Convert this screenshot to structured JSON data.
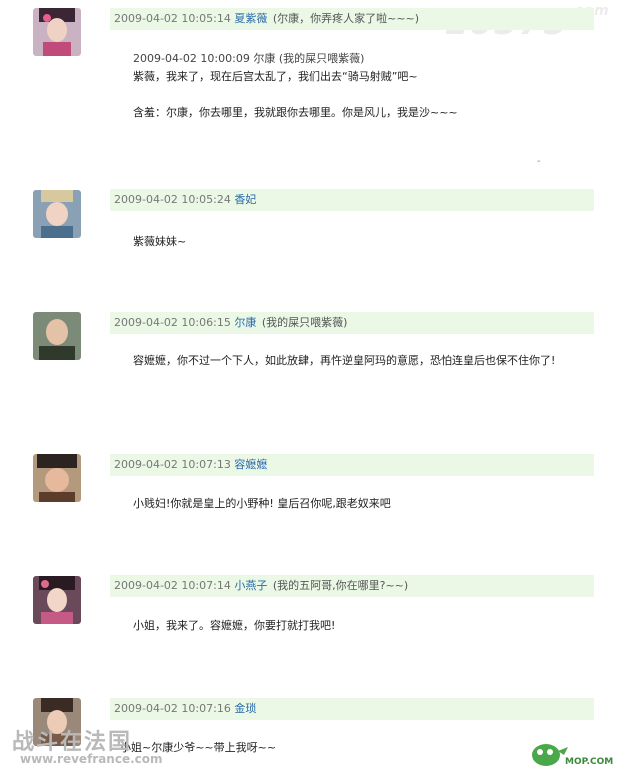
{
  "watermarks": {
    "top_right": "E0575",
    "top_right_suffix": ".com",
    "bottom_left": "战斗在法国",
    "bottom_left_url": "www.revefrance.com",
    "bottom_right": "MOP.COM"
  },
  "posts": [
    {
      "time": "2009-04-02 10:05:14",
      "user": "夏紫薇",
      "signature": "(尔康，你弄疼人家了啦~~~)",
      "quote": {
        "header": "2009-04-02 10:00:09 尔康  (我的屎只喂紫薇)",
        "lines": [
          "紫薇，我来了，现在后宫太乱了，我们出去“骑马射贼”吧~",
          "",
          "含羞：尔康，你去哪里，我就跟你去哪里。你是风儿，我是沙~~~"
        ]
      },
      "trailing_mark": "-"
    },
    {
      "time": "2009-04-02 10:05:24",
      "user": "香妃",
      "signature": "",
      "content": "紫薇妹妹~"
    },
    {
      "time": "2009-04-02 10:06:15",
      "user": "尔康",
      "signature": "(我的屎只喂紫薇)",
      "content": "容嬷嬷，你不过一个下人，如此放肆，再忤逆皇阿玛的意愿，恐怕连皇后也保不住你了!"
    },
    {
      "time": "2009-04-02 10:07:13",
      "user": "容嬷嬷",
      "signature": "",
      "content": "小贱妇!你就是皇上的小野种! 皇后召你呢,跟老奴来吧"
    },
    {
      "time": "2009-04-02 10:07:14",
      "user": "小燕子",
      "signature": "(我的五阿哥,你在哪里?~~)",
      "content": "小姐，我来了。容嬷嬷，你要打就打我吧!"
    },
    {
      "time": "2009-04-02 10:07:16",
      "user": "金琐",
      "signature": "",
      "content": "小姐~尔康少爷~~带上我呀~~"
    }
  ]
}
